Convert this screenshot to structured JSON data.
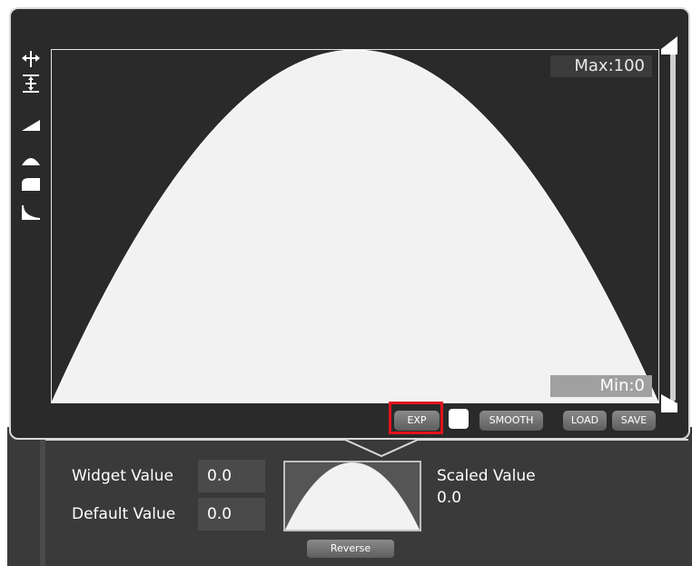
{
  "curve_editor": {
    "max_label": "Max:100",
    "min_label": "Min:0",
    "buttons": {
      "exp": "EXP",
      "smooth": "SMOOTH",
      "load": "LOAD",
      "save": "SAVE"
    },
    "swatch_color": "#ffffff",
    "highlight_color": "#e0141e",
    "tools": [
      "move-icon",
      "split-icon",
      "ramp-icon",
      "arc-icon",
      "plateau-icon",
      "ease-icon"
    ]
  },
  "properties": {
    "widget_value_label": "Widget Value",
    "widget_value": "0.0",
    "default_value_label": "Default Value",
    "default_value": "0.0",
    "scaled_value_label": "Scaled Value",
    "scaled_value": "0.0",
    "reverse_label": "Reverse"
  }
}
